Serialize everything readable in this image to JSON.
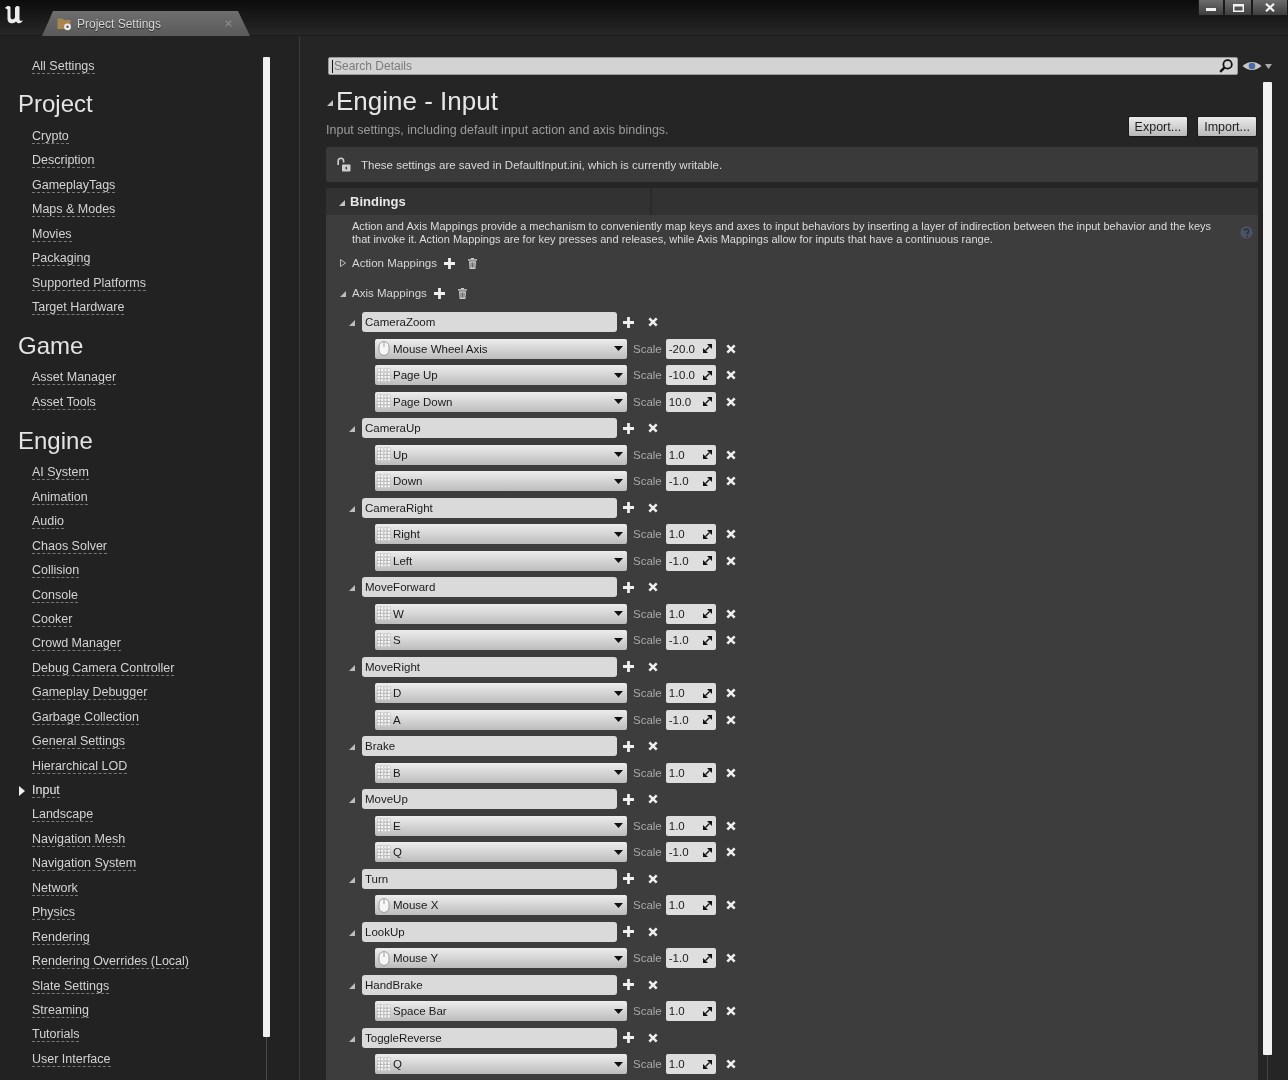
{
  "tabs": [
    {
      "label": "Project Settings",
      "selected": true
    }
  ],
  "sidebar": {
    "all_settings": "All Settings",
    "sections": [
      {
        "title": "Project",
        "items": [
          {
            "label": "Crypto",
            "selected": false
          },
          {
            "label": "Description",
            "selected": false
          },
          {
            "label": "GameplayTags",
            "selected": false
          },
          {
            "label": "Maps & Modes",
            "selected": false
          },
          {
            "label": "Movies",
            "selected": false
          },
          {
            "label": "Packaging",
            "selected": false
          },
          {
            "label": "Supported Platforms",
            "selected": false
          },
          {
            "label": "Target Hardware",
            "selected": false
          }
        ]
      },
      {
        "title": "Game",
        "items": [
          {
            "label": "Asset Manager",
            "selected": false
          },
          {
            "label": "Asset Tools",
            "selected": false
          }
        ]
      },
      {
        "title": "Engine",
        "items": [
          {
            "label": "AI System",
            "selected": false
          },
          {
            "label": "Animation",
            "selected": false
          },
          {
            "label": "Audio",
            "selected": false
          },
          {
            "label": "Chaos Solver",
            "selected": false
          },
          {
            "label": "Collision",
            "selected": false
          },
          {
            "label": "Console",
            "selected": false
          },
          {
            "label": "Cooker",
            "selected": false
          },
          {
            "label": "Crowd Manager",
            "selected": false
          },
          {
            "label": "Debug Camera Controller",
            "selected": false
          },
          {
            "label": "Gameplay Debugger",
            "selected": false
          },
          {
            "label": "Garbage Collection",
            "selected": false
          },
          {
            "label": "General Settings",
            "selected": false
          },
          {
            "label": "Hierarchical LOD",
            "selected": false
          },
          {
            "label": "Input",
            "selected": true
          },
          {
            "label": "Landscape",
            "selected": false
          },
          {
            "label": "Navigation Mesh",
            "selected": false
          },
          {
            "label": "Navigation System",
            "selected": false
          },
          {
            "label": "Network",
            "selected": false
          },
          {
            "label": "Physics",
            "selected": false
          },
          {
            "label": "Rendering",
            "selected": false
          },
          {
            "label": "Rendering Overrides (Local)",
            "selected": false
          },
          {
            "label": "Slate Settings",
            "selected": false
          },
          {
            "label": "Streaming",
            "selected": false
          },
          {
            "label": "Tutorials",
            "selected": false
          },
          {
            "label": "User Interface",
            "selected": false
          }
        ]
      }
    ]
  },
  "search": {
    "placeholder": "Search Details"
  },
  "header": {
    "title": "Engine - Input",
    "expanded": true,
    "description": "Input settings, including default input action and axis bindings.",
    "buttons": [
      "Export...",
      "Import..."
    ]
  },
  "notice": "These settings are saved in DefaultInput.ini, which is currently writable.",
  "bindings": {
    "title": "Bindings",
    "expanded": true,
    "description": "Action and Axis Mappings provide a mechanism to conveniently map keys and axes to input behaviors by inserting a layer of indirection between the input behavior and the keys that invoke it. Action Mappings are for key presses and releases, while Axis Mappings allow for inputs that have a continuous range.",
    "action_mappings": {
      "label": "Action Mappings",
      "expanded": false
    },
    "axis_mappings": {
      "label": "Axis Mappings",
      "expanded": true,
      "axes": [
        {
          "name": "CameraZoom",
          "expanded": true,
          "keys": [
            {
              "key": "Mouse Wheel Axis",
              "kind": "mouse",
              "scale_label": "Scale",
              "scale": "-20.0"
            },
            {
              "key": "Page Up",
              "kind": "keyboard",
              "scale_label": "Scale",
              "scale": "-10.0"
            },
            {
              "key": "Page Down",
              "kind": "keyboard",
              "scale_label": "Scale",
              "scale": "10.0"
            }
          ]
        },
        {
          "name": "CameraUp",
          "expanded": true,
          "keys": [
            {
              "key": "Up",
              "kind": "keyboard",
              "scale_label": "Scale",
              "scale": "1.0"
            },
            {
              "key": "Down",
              "kind": "keyboard",
              "scale_label": "Scale",
              "scale": "-1.0"
            }
          ]
        },
        {
          "name": "CameraRight",
          "expanded": true,
          "keys": [
            {
              "key": "Right",
              "kind": "keyboard",
              "scale_label": "Scale",
              "scale": "1.0"
            },
            {
              "key": "Left",
              "kind": "keyboard",
              "scale_label": "Scale",
              "scale": "-1.0"
            }
          ]
        },
        {
          "name": "MoveForward",
          "expanded": true,
          "keys": [
            {
              "key": "W",
              "kind": "keyboard",
              "scale_label": "Scale",
              "scale": "1.0"
            },
            {
              "key": "S",
              "kind": "keyboard",
              "scale_label": "Scale",
              "scale": "-1.0"
            }
          ]
        },
        {
          "name": "MoveRight",
          "expanded": true,
          "keys": [
            {
              "key": "D",
              "kind": "keyboard",
              "scale_label": "Scale",
              "scale": "1.0"
            },
            {
              "key": "A",
              "kind": "keyboard",
              "scale_label": "Scale",
              "scale": "-1.0"
            }
          ]
        },
        {
          "name": "Brake",
          "expanded": true,
          "keys": [
            {
              "key": "B",
              "kind": "keyboard",
              "scale_label": "Scale",
              "scale": "1.0"
            }
          ]
        },
        {
          "name": "MoveUp",
          "expanded": true,
          "keys": [
            {
              "key": "E",
              "kind": "keyboard",
              "scale_label": "Scale",
              "scale": "1.0"
            },
            {
              "key": "Q",
              "kind": "keyboard",
              "scale_label": "Scale",
              "scale": "-1.0"
            }
          ]
        },
        {
          "name": "Turn",
          "expanded": true,
          "keys": [
            {
              "key": "Mouse X",
              "kind": "mouse",
              "scale_label": "Scale",
              "scale": "1.0"
            }
          ]
        },
        {
          "name": "LookUp",
          "expanded": true,
          "keys": [
            {
              "key": "Mouse Y",
              "kind": "mouse",
              "scale_label": "Scale",
              "scale": "-1.0"
            }
          ]
        },
        {
          "name": "HandBrake",
          "expanded": true,
          "keys": [
            {
              "key": "Space Bar",
              "kind": "keyboard",
              "scale_label": "Scale",
              "scale": "1.0"
            }
          ]
        },
        {
          "name": "ToggleReverse",
          "expanded": true,
          "keys": [
            {
              "key": "Q",
              "kind": "keyboard",
              "scale_label": "Scale",
              "scale": "1.0"
            }
          ]
        }
      ]
    }
  }
}
